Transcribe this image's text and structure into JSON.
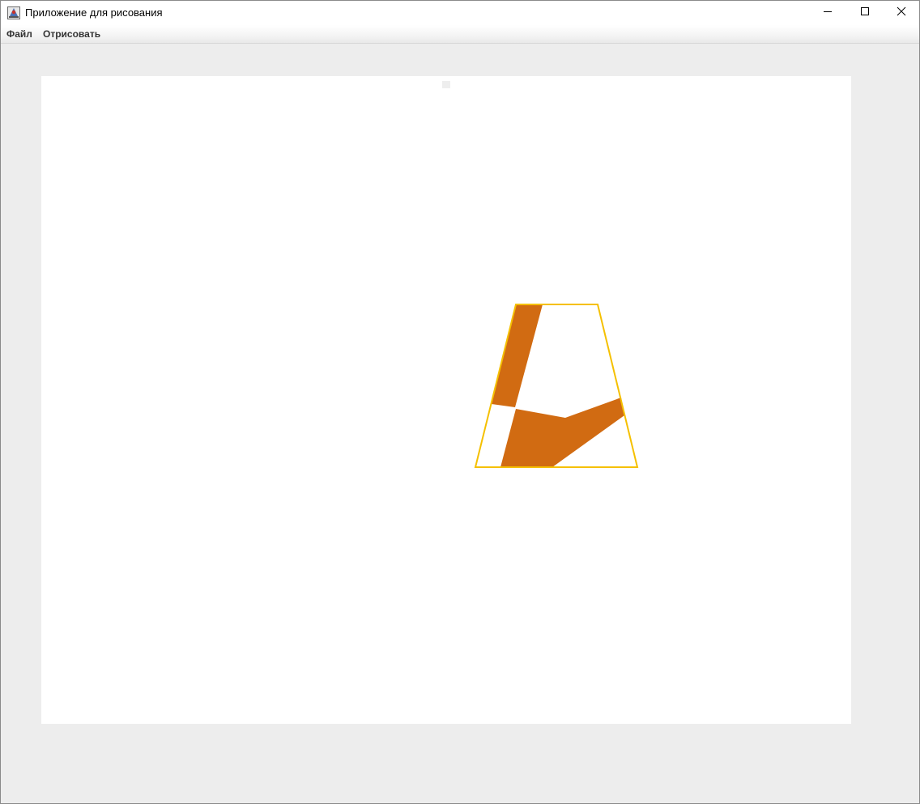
{
  "window": {
    "title": "Приложение для рисования"
  },
  "menu": {
    "file_label": "Файл",
    "draw_label": "Отрисовать"
  },
  "drawing": {
    "outline_color": "#f5c000",
    "fill_color": "#d16b12",
    "canvas_color": "#ffffff"
  },
  "icons": {
    "app": "app-icon",
    "minimize": "minimize-icon",
    "maximize": "maximize-icon",
    "close": "close-icon"
  }
}
